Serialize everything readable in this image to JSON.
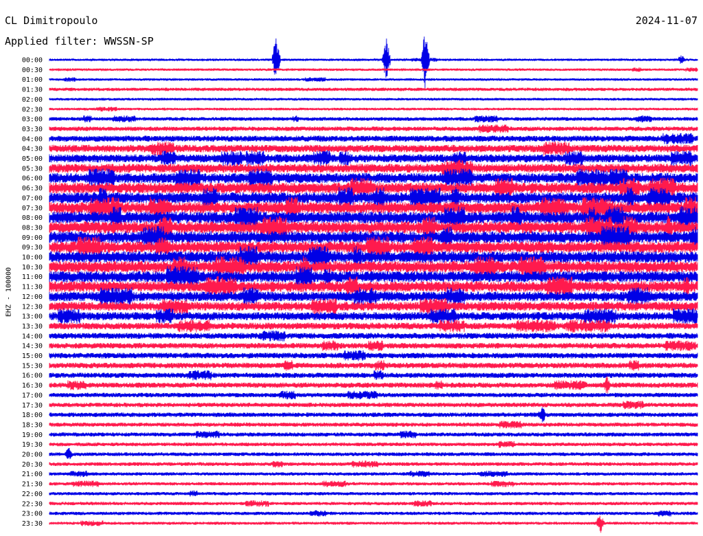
{
  "header": {
    "station": "CL Dimitropoulo",
    "filter": "Applied filter: WWSSN-SP",
    "date": "2024-11-07"
  },
  "colors": {
    "trace_a": "#0000e6",
    "trace_b": "#ff1a4d",
    "text": "#000000",
    "background": "#ffffff"
  },
  "chart_data": {
    "type": "line",
    "channel_label": "EHZ - 100000",
    "row_labels": [
      "00:00",
      "00:30",
      "01:00",
      "01:30",
      "02:00",
      "02:30",
      "03:00",
      "03:30",
      "04:00",
      "04:30",
      "05:00",
      "05:30",
      "06:00",
      "06:30",
      "07:00",
      "07:30",
      "08:00",
      "08:30",
      "09:00",
      "09:30",
      "10:00",
      "10:30",
      "11:00",
      "11:30",
      "12:00",
      "12:30",
      "13:00",
      "13:30",
      "14:00",
      "14:30",
      "15:00",
      "15:30",
      "16:00",
      "16:30",
      "17:00",
      "17:30",
      "18:00",
      "18:30",
      "19:00",
      "19:30",
      "20:00",
      "20:30",
      "21:00",
      "21:30",
      "22:00",
      "22:30",
      "23:00",
      "23:30"
    ],
    "row_colors": [
      "blue",
      "red"
    ],
    "noise_level": [
      0.3,
      0.32,
      0.32,
      0.45,
      0.35,
      0.35,
      0.5,
      0.6,
      0.8,
      1.0,
      1.1,
      1.2,
      1.35,
      1.45,
      1.5,
      1.55,
      1.6,
      1.6,
      1.6,
      1.55,
      1.55,
      1.55,
      1.5,
      1.45,
      1.3,
      1.2,
      1.1,
      0.9,
      0.8,
      0.75,
      0.75,
      0.75,
      0.7,
      0.7,
      0.6,
      0.6,
      0.6,
      0.55,
      0.55,
      0.5,
      0.5,
      0.5,
      0.45,
      0.45,
      0.45,
      0.45,
      0.45,
      0.4
    ],
    "events": [
      {
        "row": 0,
        "time_fraction": 0.35,
        "amplitude": 7.0
      },
      {
        "row": 0,
        "time_fraction": 0.52,
        "amplitude": 6.0
      },
      {
        "row": 0,
        "time_fraction": 0.58,
        "amplitude": 9.0
      },
      {
        "row": 0,
        "time_fraction": 0.975,
        "amplitude": 1.5
      },
      {
        "row": 33,
        "time_fraction": 0.86,
        "amplitude": 2.5
      },
      {
        "row": 36,
        "time_fraction": 0.76,
        "amplitude": 3.0
      },
      {
        "row": 40,
        "time_fraction": 0.03,
        "amplitude": 2.0
      },
      {
        "row": 47,
        "time_fraction": 0.85,
        "amplitude": 3.0
      }
    ]
  }
}
